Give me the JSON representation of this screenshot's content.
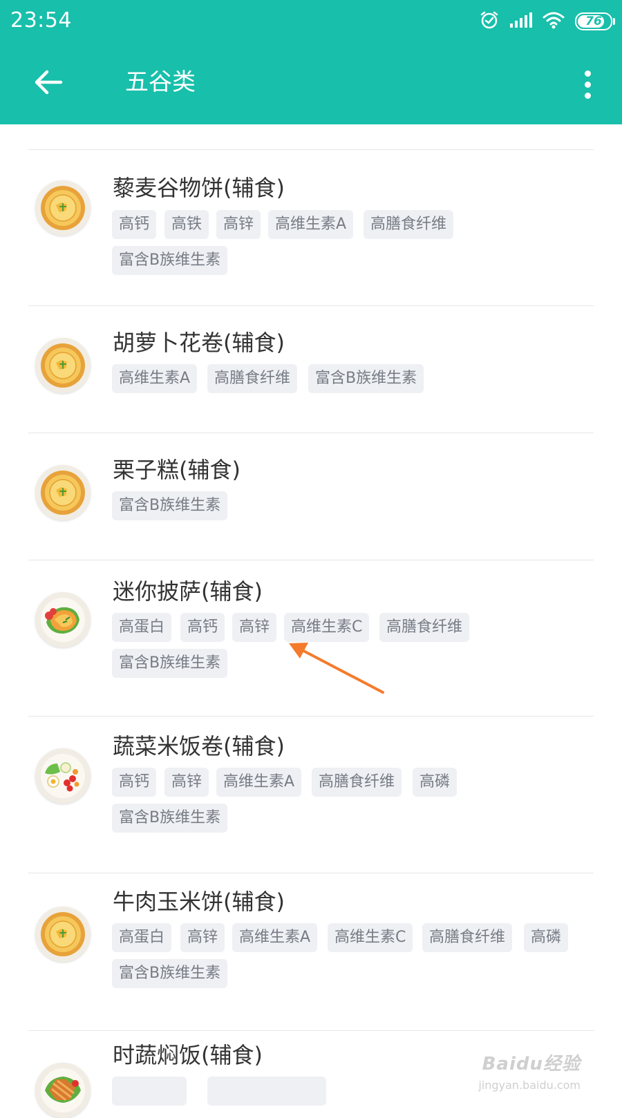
{
  "status_bar": {
    "time": "23:54",
    "battery": "76",
    "icons": [
      "alarm-icon",
      "signal-icon",
      "wifi-icon",
      "battery-icon"
    ]
  },
  "toolbar": {
    "title": "五谷类",
    "back_icon": "back-arrow-icon",
    "more_icon": "more-vert-icon"
  },
  "items": [
    {
      "name": "藜麦谷物饼(辅食)",
      "tags": [
        "高钙",
        "高铁",
        "高锌",
        "高维生素A",
        "高膳食纤维",
        "富含B族维生素"
      ],
      "image_icon": "soup-bowl-icon"
    },
    {
      "name": "胡萝卜花卷(辅食)",
      "tags": [
        "高维生素A",
        "高膳食纤维",
        "富含B族维生素"
      ],
      "image_icon": "soup-bowl-icon"
    },
    {
      "name": "栗子糕(辅食)",
      "tags": [
        "富含B族维生素"
      ],
      "image_icon": "soup-bowl-icon"
    },
    {
      "name": "迷你披萨(辅食)",
      "tags": [
        "高蛋白",
        "高钙",
        "高锌",
        "高维生素C",
        "高膳食纤维",
        "富含B族维生素"
      ],
      "image_icon": "pizza-plate-icon"
    },
    {
      "name": "蔬菜米饭卷(辅食)",
      "tags": [
        "高钙",
        "高锌",
        "高维生素A",
        "高膳食纤维",
        "高磷",
        "富含B族维生素"
      ],
      "image_icon": "salad-plate-icon"
    },
    {
      "name": "牛肉玉米饼(辅食)",
      "tags": [
        "高蛋白",
        "高锌",
        "高维生素A",
        "高维生素C",
        "高膳食纤维",
        "高磷",
        "富含B族维生素"
      ],
      "image_icon": "soup-bowl-icon"
    },
    {
      "name": "时蔬焖饭(辅食)",
      "tags": [],
      "image_icon": "meat-plate-icon"
    }
  ],
  "watermark": {
    "brand": "Baidu经验",
    "url": "jingyan.baidu.com"
  },
  "colors": {
    "primary": "#18bfab",
    "tag_bg": "#eef0f4",
    "tag_text": "#777b84",
    "arrow": "#f47b2c"
  }
}
